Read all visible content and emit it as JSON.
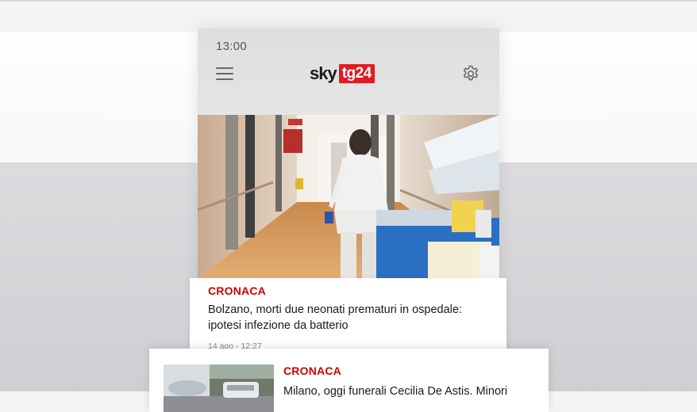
{
  "status_bar": {
    "time": "13:00"
  },
  "header": {
    "logo_sky": "sky",
    "logo_tg": "tg24",
    "menu_icon": "hamburger-menu-icon",
    "settings_icon": "gear-icon"
  },
  "colors": {
    "accent": "#e21a22",
    "category": "#cc0000"
  },
  "articles": [
    {
      "category": "CRONACA",
      "title": "Bolzano, morti due neonati prematuri in ospedale: ipotesi infezione da batterio",
      "meta": "14 ago - 12:27"
    },
    {
      "category": "CRONACA",
      "title": "Milano, oggi funerali Cecilia De Astis. Minori"
    }
  ]
}
